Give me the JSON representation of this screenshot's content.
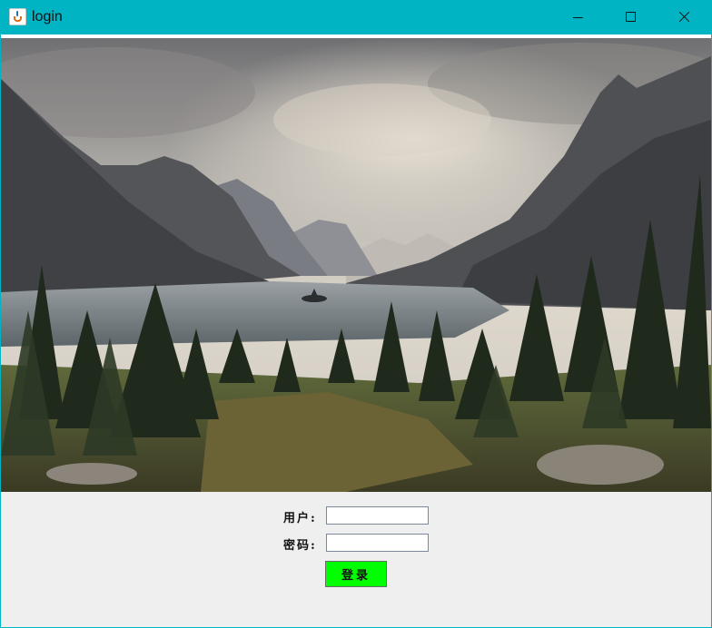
{
  "window": {
    "title": "login",
    "icon": "java-cup-icon",
    "controls": [
      "minimize-icon",
      "maximize-icon",
      "close-icon"
    ]
  },
  "form": {
    "user_label": "用户:",
    "user_value": "",
    "password_label": "密码:",
    "password_value": "",
    "login_label": "登录"
  },
  "colors": {
    "titlebar": "#00b4c4",
    "client_bg": "#efefef",
    "login_button": "#00ff00"
  }
}
